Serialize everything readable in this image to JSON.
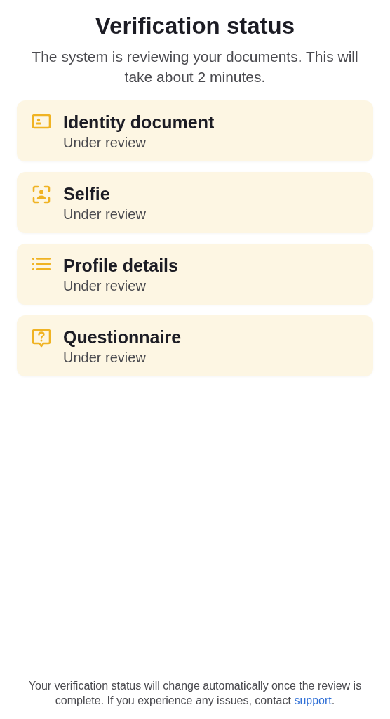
{
  "title": "Verification status",
  "subtitle": "The system is reviewing your documents. This will take about 2 minutes.",
  "items": [
    {
      "kind": "id-card",
      "title": "Identity document",
      "status": "Under review"
    },
    {
      "kind": "selfie",
      "title": "Selfie",
      "status": "Under review"
    },
    {
      "kind": "list",
      "title": "Profile details",
      "status": "Under review"
    },
    {
      "kind": "question",
      "title": "Questionnaire",
      "status": "Under review"
    }
  ],
  "footer": {
    "text": "Your verification status will change automatically once the review is complete. If you experience any issues, contact ",
    "link": "support",
    "after": "."
  }
}
